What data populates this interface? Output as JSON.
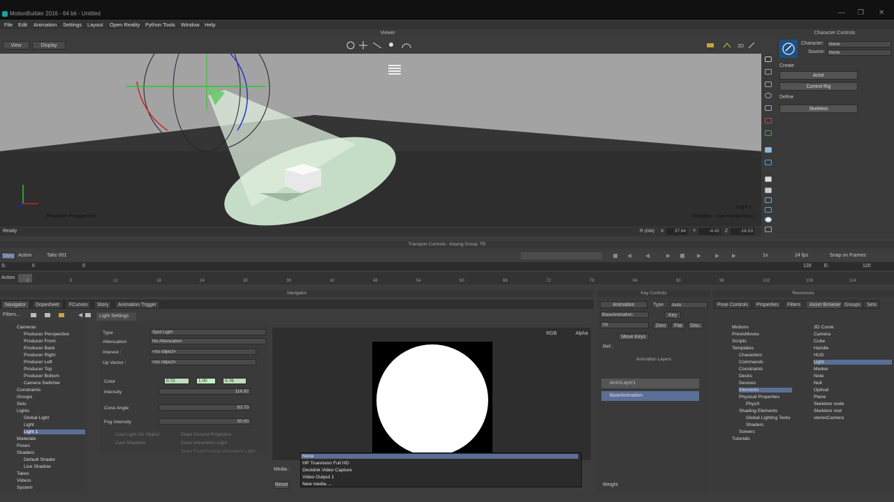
{
  "app": {
    "title": "MotionBuilder 2016 - 64 bit - Untitled"
  },
  "menu": [
    "File",
    "Edit",
    "Animation",
    "Settings",
    "Layout",
    "Open Reality",
    "Python Tools",
    "Window",
    "Help"
  ],
  "viewer": {
    "header": "Viewer",
    "view_btn": "View",
    "display_btn": "Display",
    "camera_label": "Producer Perspective",
    "selection_label": "Light 1",
    "rotation_label": "Rotation: Use manipulator",
    "status": "Ready"
  },
  "rgb": {
    "label": "R (Gbl)",
    "x_label": "X",
    "x": "37.94",
    "y_label": "Y",
    "y": "-4.42",
    "z_label": "Z",
    "z": "-16.53"
  },
  "character_controls": {
    "header": "Character Controls",
    "character_label": "Character:",
    "character_value": "None",
    "source_label": "Source:",
    "source_value": "None",
    "create_label": "Create",
    "actor_btn": "Actor",
    "control_rig_btn": "Control Rig",
    "define_label": "Define",
    "skeleton_btn": "Skeleton"
  },
  "transport": {
    "header": "Transport Controls - Keying Group: TR",
    "story": "Story",
    "action": "Action",
    "take": "Take 001",
    "fps_mode": "1x",
    "fps": "24 fps",
    "snap": "Snap on Frames",
    "start_label": "S:",
    "start": "0",
    "end_label": "E:",
    "end": "120",
    "current": "0",
    "end2": "120",
    "action_label": "Action"
  },
  "ruler": [
    "0",
    "6",
    "12",
    "18",
    "24",
    "30",
    "36",
    "42",
    "48",
    "54",
    "60",
    "66",
    "72",
    "78",
    "84",
    "90",
    "96",
    "102",
    "108",
    "114"
  ],
  "navigator": {
    "header": "Navigator",
    "tabs": [
      "Navigator",
      "Dopesheet",
      "FCurves",
      "Story",
      "Animation Trigger"
    ],
    "filters": "Filters..."
  },
  "tree": [
    {
      "label": "Cameras",
      "indent": 1
    },
    {
      "label": "Producer Perspective",
      "indent": 2
    },
    {
      "label": "Producer Front",
      "indent": 2
    },
    {
      "label": "Producer Back",
      "indent": 2
    },
    {
      "label": "Producer Right",
      "indent": 2
    },
    {
      "label": "Producer Left",
      "indent": 2
    },
    {
      "label": "Producer Top",
      "indent": 2
    },
    {
      "label": "Producer Bottom",
      "indent": 2
    },
    {
      "label": "Camera Switcher",
      "indent": 2
    },
    {
      "label": "Constraints",
      "indent": 1
    },
    {
      "label": "Groups",
      "indent": 1
    },
    {
      "label": "Sets",
      "indent": 1
    },
    {
      "label": "Lights",
      "indent": 1
    },
    {
      "label": "Global Light",
      "indent": 2
    },
    {
      "label": "Light",
      "indent": 2
    },
    {
      "label": "Light 1",
      "indent": 2,
      "selected": true
    },
    {
      "label": "Materials",
      "indent": 1
    },
    {
      "label": "Poses",
      "indent": 1
    },
    {
      "label": "Shaders",
      "indent": 1
    },
    {
      "label": "Default Shader",
      "indent": 2
    },
    {
      "label": "Live Shadow",
      "indent": 2
    },
    {
      "label": "Takes",
      "indent": 1
    },
    {
      "label": "Videos",
      "indent": 1
    },
    {
      "label": "System",
      "indent": 1
    }
  ],
  "light_settings": {
    "tab": "Light Settings",
    "type_label": "Type",
    "type": "Spot Light",
    "attenuation_label": "Attenuation",
    "attenuation": "No Attenuation",
    "interest_label": "Interest :",
    "interest": "<no object>",
    "upvector_label": "Up Vector :",
    "upvector": "<no object>",
    "color_label": "Color",
    "r": "0.72",
    "g": "1.00",
    "b": "0.76",
    "intensity_label": "Intensity",
    "intensity": "116.92",
    "cone_label": "Cone Angle",
    "cone": "83.70",
    "fog_label": "Fog Intensity",
    "fog": "50.00",
    "cast_light": "Cast Light On Object",
    "cast_shadows": "Cast Shadows",
    "draw_ground": "Draw Ground Projection",
    "draw_vol": "Draw Volumetric Light",
    "draw_front": "Draw Front-Facing Volumetric Light",
    "rgb_opt": "RGB",
    "alpha_opt": "Alpha",
    "media_label": "Media :",
    "reset_btn": "Reset"
  },
  "media_dropdown": [
    "None",
    "HP Truevision Full HD",
    "Decklink Video Capture",
    "Video Output 1",
    "New media ..."
  ],
  "key_controls": {
    "header": "Key Controls",
    "animation": "Animation",
    "type_label": "Type :",
    "type": "Auto",
    "base_anim": "BaseAnimation",
    "key_btn": "Key",
    "tr": "TR",
    "zero": "Zero",
    "flat": "Flat",
    "disc": "Disc.",
    "move_keys": "Move Keys",
    "ref_label": "Ref.:",
    "layers_header": "Animation Layers",
    "layer1": "AnimLayer1",
    "layer2": "BaseAnimation",
    "weight_label": "Weight"
  },
  "resources": {
    "header": "Resources",
    "tabs": [
      "Pose Controls",
      "Properties",
      "Filters",
      "Asset Browser",
      "Groups",
      "Sets"
    ],
    "folders": [
      {
        "label": "Motions",
        "i": 0
      },
      {
        "label": "PrevisMoves",
        "i": 0
      },
      {
        "label": "Scripts",
        "i": 0
      },
      {
        "label": "Templates",
        "i": 0
      },
      {
        "label": "Characters",
        "i": 1
      },
      {
        "label": "Commands",
        "i": 1
      },
      {
        "label": "Constraints",
        "i": 1
      },
      {
        "label": "Decks",
        "i": 1
      },
      {
        "label": "Devices",
        "i": 1
      },
      {
        "label": "Elements",
        "i": 1,
        "selected": true
      },
      {
        "label": "Physical Properties",
        "i": 1
      },
      {
        "label": "PhysX",
        "i": 2
      },
      {
        "label": "Shading Elements",
        "i": 1
      },
      {
        "label": "Global Lighting Textu",
        "i": 2
      },
      {
        "label": "Shaders",
        "i": 2
      },
      {
        "label": "Solvers",
        "i": 1
      },
      {
        "label": "Tutorials",
        "i": 0
      }
    ],
    "assets": [
      {
        "label": "3D Curve"
      },
      {
        "label": "Camera"
      },
      {
        "label": "Cube"
      },
      {
        "label": "Handle"
      },
      {
        "label": "HUD"
      },
      {
        "label": "Light",
        "selected": true
      },
      {
        "label": "Marker"
      },
      {
        "label": "Note"
      },
      {
        "label": "Null"
      },
      {
        "label": "Optical"
      },
      {
        "label": "Plane"
      },
      {
        "label": "Skeleton node"
      },
      {
        "label": "Skeleton root"
      },
      {
        "label": "stereoCamera"
      }
    ]
  }
}
